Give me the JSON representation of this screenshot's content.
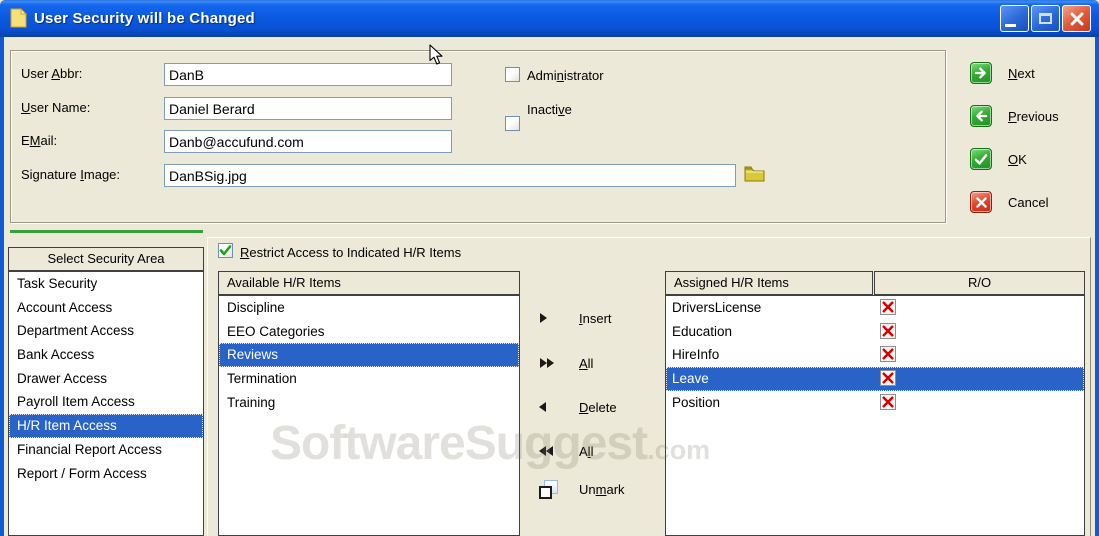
{
  "window": {
    "title": "User Security will be Changed",
    "buttons": {
      "minimize": "minimize",
      "maximize": "maximize",
      "close": "close"
    }
  },
  "form": {
    "fields": [
      {
        "pre": "User ",
        "key": "A",
        "post": "bbr:",
        "value": "DanB"
      },
      {
        "pre": "",
        "key": "U",
        "post": "ser Name:",
        "value": "Daniel Berard"
      },
      {
        "pre": "E",
        "key": "M",
        "post": "ail:",
        "value": "Danb@accufund.com"
      },
      {
        "pre": "Signature ",
        "key": "I",
        "post": "mage:",
        "value": "DanBSig.jpg",
        "browse_icon": "folder-icon"
      }
    ],
    "checkboxes": [
      {
        "pre": "Admi",
        "key": "n",
        "post": "istrator",
        "checked": false
      },
      {
        "pre": "Inacti",
        "key": "v",
        "post": "e",
        "checked": false
      }
    ]
  },
  "actions": [
    {
      "pre": "",
      "key": "N",
      "post": "ext",
      "icon": "arrow-right-icon",
      "color": "green"
    },
    {
      "pre": "",
      "key": "P",
      "post": "revious",
      "icon": "arrow-left-icon",
      "color": "green"
    },
    {
      "pre": "",
      "key": "O",
      "post": "K",
      "icon": "check-icon",
      "color": "green"
    },
    {
      "pre": "Cancel",
      "key": "",
      "post": "",
      "icon": "cross-icon",
      "color": "red"
    }
  ],
  "security_areas": {
    "header": "Select Security Area",
    "items": [
      "Task Security",
      "Account Access",
      "Department Access",
      "Bank Access",
      "Drawer Access",
      "Payroll Item Access",
      "H/R Item Access",
      "Financial Report Access",
      "Report / Form Access"
    ],
    "selected": "H/R Item Access"
  },
  "restrict": {
    "pre": "",
    "key": "R",
    "post": "estrict Access to Indicated H/R Items",
    "checked": true
  },
  "available": {
    "header": "Available H/R Items",
    "items": [
      "Discipline",
      "EEO Categories",
      "Reviews",
      "Termination",
      "Training"
    ],
    "selected": "Reviews"
  },
  "transfer": [
    {
      "pre": "",
      "key": "I",
      "post": "nsert",
      "icon": "triangle-right-icon"
    },
    {
      "pre": "",
      "key": "A",
      "post": "ll",
      "icon": "double-triangle-right-icon"
    },
    {
      "pre": "",
      "key": "D",
      "post": "elete",
      "icon": "triangle-left-icon"
    },
    {
      "pre": "A",
      "key": "l",
      "post": "l",
      "icon": "double-triangle-left-icon"
    },
    {
      "pre": "Un",
      "key": "m",
      "post": "ark",
      "icon": "unmark-square-icon"
    }
  ],
  "assigned": {
    "headers": [
      "Assigned H/R Items",
      "R/O"
    ],
    "rows": [
      {
        "name": "DriversLicense",
        "readonly": true
      },
      {
        "name": "Education",
        "readonly": true
      },
      {
        "name": "HireInfo",
        "readonly": true
      },
      {
        "name": "Leave",
        "readonly": true
      },
      {
        "name": "Position",
        "readonly": true
      }
    ],
    "selected": "Leave"
  },
  "watermark": {
    "text": "SoftwareSuggest",
    "suffix": ".com"
  },
  "colors": {
    "titlebar_blue": "#0B5AE2",
    "window_bg": "#ECE9D8",
    "selection_blue": "#2A63C8",
    "green_line": "#35A038",
    "action_green": "#2FA32F",
    "action_red": "#DB3A22",
    "readonly_x_red": "#D40000",
    "input_border": "#7F9DB9"
  }
}
